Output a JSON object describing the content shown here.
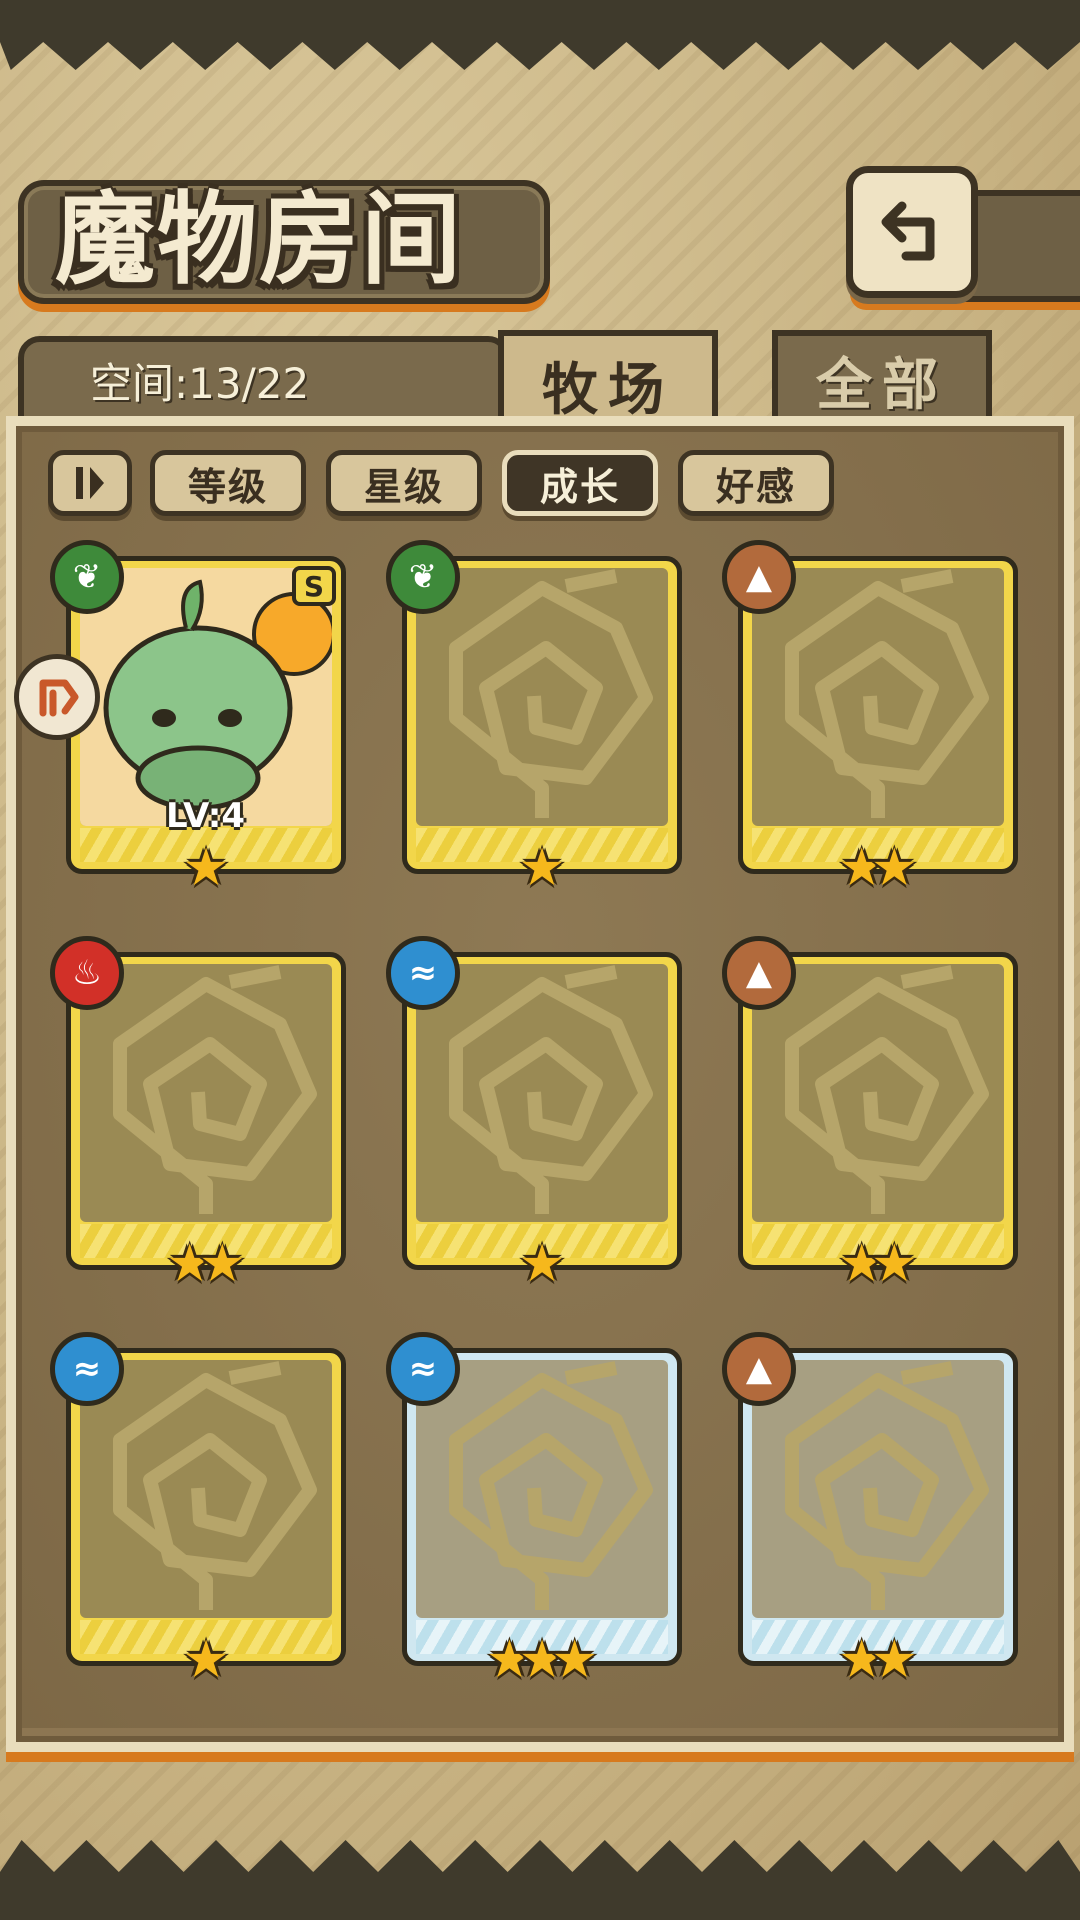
{
  "header": {
    "title": "魔物房间",
    "back_icon": "return-arrow-icon"
  },
  "storage": {
    "label": "空间:13/22"
  },
  "tabs": [
    {
      "label": "牧场",
      "active": true
    },
    {
      "label": "全部",
      "active": false
    }
  ],
  "sort": {
    "toggle_icon": "sort-order-icon",
    "buttons": [
      {
        "label": "等级",
        "active": false
      },
      {
        "label": "星级",
        "active": false
      },
      {
        "label": "成长",
        "active": true
      },
      {
        "label": "好感",
        "active": false
      }
    ]
  },
  "cards": [
    {
      "element": "grass",
      "element_color": "#3e8a3a",
      "stars": 1,
      "frame": "gold",
      "revealed": true,
      "level": "LV:4",
      "grade": "S"
    },
    {
      "element": "grass",
      "element_color": "#3e8a3a",
      "stars": 1,
      "frame": "gold",
      "revealed": false
    },
    {
      "element": "earth",
      "element_color": "#b26a3c",
      "stars": 2,
      "frame": "gold",
      "revealed": false
    },
    {
      "element": "fire",
      "element_color": "#d23028",
      "stars": 2,
      "frame": "gold",
      "revealed": false
    },
    {
      "element": "water",
      "element_color": "#2f8fd0",
      "stars": 1,
      "frame": "gold",
      "revealed": false
    },
    {
      "element": "earth",
      "element_color": "#b26a3c",
      "stars": 2,
      "frame": "gold",
      "revealed": false
    },
    {
      "element": "water",
      "element_color": "#2f8fd0",
      "stars": 1,
      "frame": "gold",
      "revealed": false
    },
    {
      "element": "water",
      "element_color": "#2f8fd0",
      "stars": 3,
      "frame": "blue",
      "revealed": false
    },
    {
      "element": "earth",
      "element_color": "#b26a3c",
      "stars": 2,
      "frame": "blue",
      "revealed": false
    }
  ],
  "side_badge_icon": "arrow-badge-icon",
  "colors": {
    "accent_orange": "#d77a1e",
    "frame_gold": "#f2d64a",
    "frame_blue": "#cfe7f0",
    "dark_outline": "#3d3323"
  }
}
